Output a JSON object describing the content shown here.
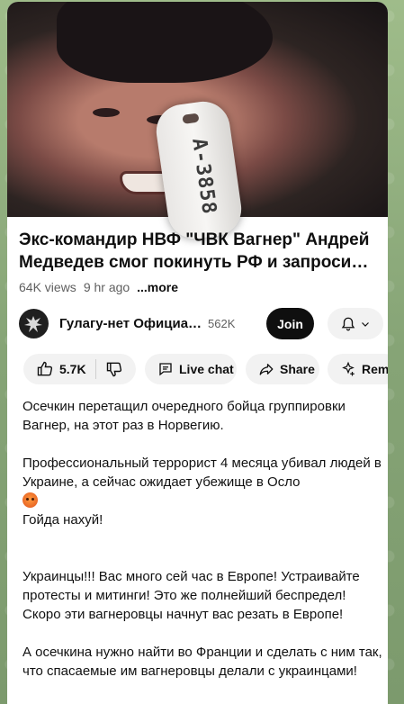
{
  "video": {
    "thumbnail_tag_text": "A-3858",
    "title_line1": "Экс-командир НВФ \"ЧВК Вагнер\" Андрей",
    "title_line2": "Медведев смог покинуть РФ и запроси…",
    "views": "64K views",
    "age": "9 hr ago",
    "more_label": "...more"
  },
  "channel": {
    "name": "Гулагу-нет Официа…",
    "subscribers": "562K",
    "join_label": "Join",
    "bell_icon": "bell-icon"
  },
  "actions": {
    "likes": "5.7K",
    "live_chat_label": "Live chat",
    "share_label": "Share",
    "remix_label": "Remix"
  },
  "post": {
    "p1": "Осечкин перетащил очередного бойца группировки Вагнер, на этот раз в Норвегию.",
    "p2": "Профессиональный террорист 4 месяца убивал людей в Украине, а сейчас ожидает убежище в Осло",
    "p3": "Гойда нахуй!",
    "p4": "Украинцы!!! Вас много сей час в Европе! Устраивайте протесты и митинги! Это же полнейший беспредел! Скоро эти вагнеровцы начнут вас резать в Европе!",
    "p5": "А осечкина нужно найти во Франции и сделать с ним так, что спасаемые им вагнеровцы делали с украинцами!"
  },
  "colors": {
    "join_bg": "#0f0f0f",
    "pill_bg": "#f2f2f2",
    "chat_bg": "#8aa67c"
  }
}
